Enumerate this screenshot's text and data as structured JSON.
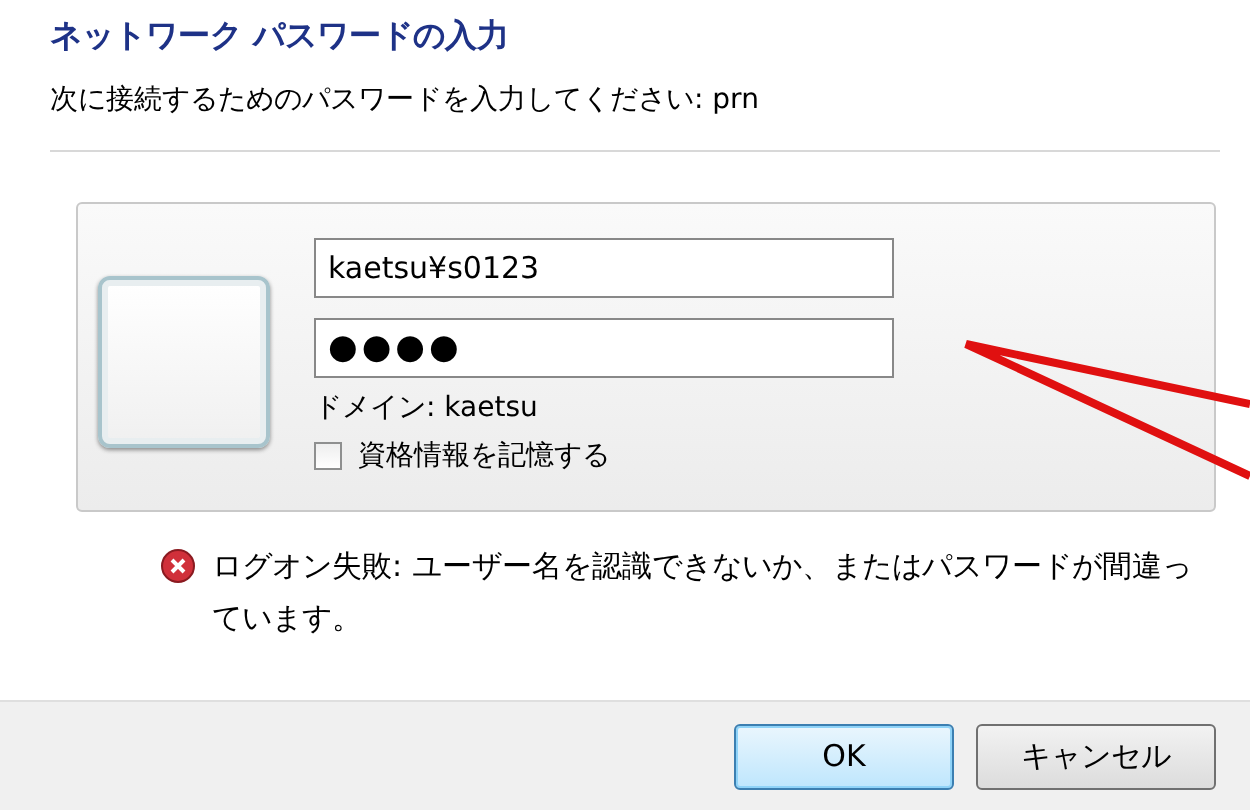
{
  "window": {
    "title": "ネットワーク パスワードの入力",
    "subtitle": "次に接続するためのパスワードを入力してください: prn"
  },
  "credentials": {
    "username": "kaetsu¥s0123",
    "password": "●●●●",
    "domain": "ドメイン: kaetsu",
    "remember": {
      "label": "資格情報を記憶する",
      "checked": false
    }
  },
  "error": {
    "message": "ログオン失敗: ユーザー名を認識できないか、またはパスワードが間違っています。"
  },
  "buttons": [
    {
      "label": "OK",
      "default": true
    },
    {
      "label": "キャンセル",
      "default": false
    }
  ]
}
